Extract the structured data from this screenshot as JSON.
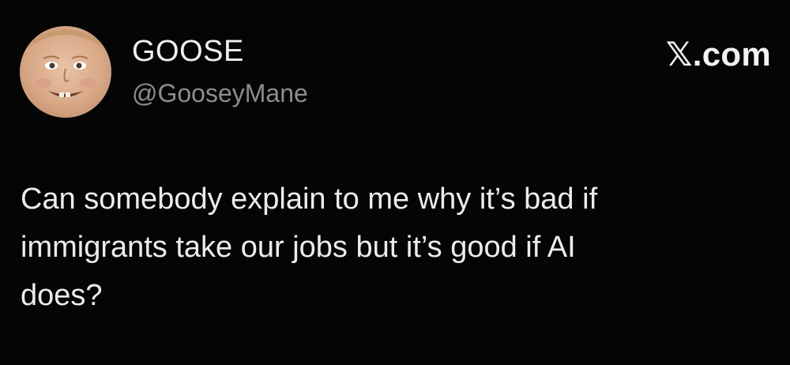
{
  "tweet": {
    "author": {
      "display_name": "GOOSE",
      "handle": "@GooseyMane",
      "avatar_icon": "child-face-avatar"
    },
    "brand": {
      "mark": "𝕏",
      "suffix": ".com"
    },
    "text": "Can somebody explain to me why it’s bad if\nimmigrants take our jobs but it’s good if AI\ndoes?"
  },
  "colors": {
    "background": "#000000",
    "text": "#ececec",
    "handle": "#8a8d91"
  }
}
